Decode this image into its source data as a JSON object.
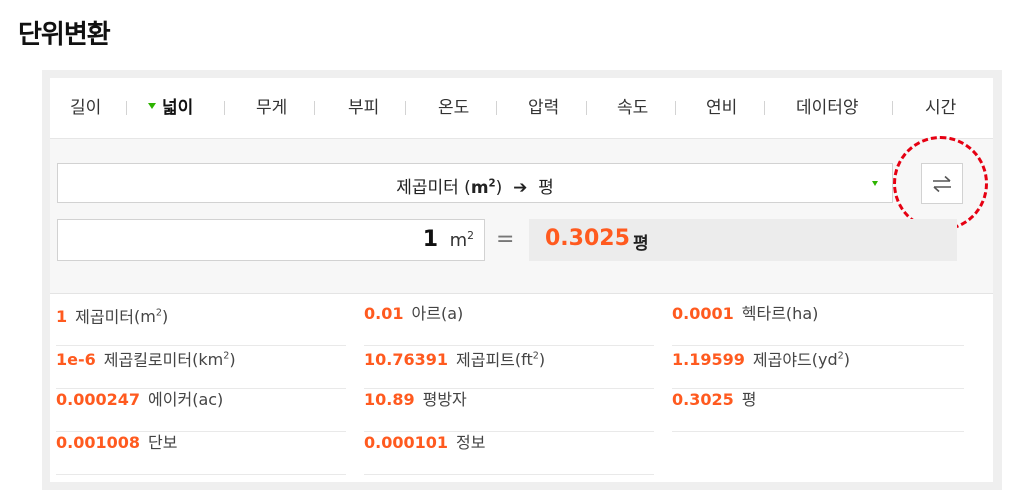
{
  "page_title": "단위변환",
  "tabs": [
    {
      "label": "길이",
      "active": false
    },
    {
      "label": "넓이",
      "active": true
    },
    {
      "label": "무게",
      "active": false
    },
    {
      "label": "부피",
      "active": false
    },
    {
      "label": "온도",
      "active": false
    },
    {
      "label": "압력",
      "active": false
    },
    {
      "label": "속도",
      "active": false
    },
    {
      "label": "연비",
      "active": false
    },
    {
      "label": "데이터양",
      "active": false
    },
    {
      "label": "시간",
      "active": false
    }
  ],
  "converter": {
    "from_unit_name": "제곱미터",
    "from_unit_symbol": "m",
    "from_unit_sup": "2",
    "arrow": "➔",
    "to_unit_name": "평",
    "input_value": "1",
    "input_unit": "m",
    "input_unit_sup": "2",
    "equals": "=",
    "result_value": "0.3025",
    "result_unit": "평"
  },
  "results": [
    {
      "value": "1",
      "name": "제곱미터",
      "unit": "m",
      "sup": "2"
    },
    {
      "value": "0.01",
      "name": "아르",
      "unit": "a",
      "sup": ""
    },
    {
      "value": "0.0001",
      "name": "헥타르",
      "unit": "ha",
      "sup": ""
    },
    {
      "value": "1e-6",
      "name": "제곱킬로미터",
      "unit": "km",
      "sup": "2"
    },
    {
      "value": "10.76391",
      "name": "제곱피트",
      "unit": "ft",
      "sup": "2"
    },
    {
      "value": "1.19599",
      "name": "제곱야드",
      "unit": "yd",
      "sup": "2"
    },
    {
      "value": "0.000247",
      "name": "에이커",
      "unit": "ac",
      "sup": ""
    },
    {
      "value": "10.89",
      "name": "평방자",
      "unit": "",
      "sup": ""
    },
    {
      "value": "0.3025",
      "name": "평",
      "unit": "",
      "sup": ""
    },
    {
      "value": "0.001008",
      "name": "단보",
      "unit": "",
      "sup": ""
    },
    {
      "value": "0.000101",
      "name": "정보",
      "unit": "",
      "sup": ""
    }
  ],
  "colors": {
    "accent": "#ff5a1f",
    "tab_marker": "#2db400",
    "highlight": "#e60012"
  },
  "icons": {
    "swap": "swap-arrows-icon",
    "dropdown": "dropdown-caret-icon",
    "active_tab": "caret-down-icon"
  }
}
